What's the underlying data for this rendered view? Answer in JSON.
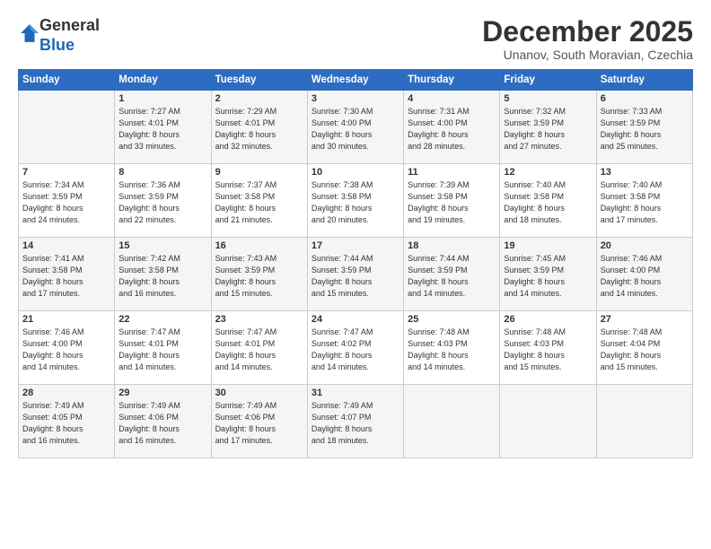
{
  "logo": {
    "general": "General",
    "blue": "Blue"
  },
  "header": {
    "month": "December 2025",
    "location": "Unanov, South Moravian, Czechia"
  },
  "weekdays": [
    "Sunday",
    "Monday",
    "Tuesday",
    "Wednesday",
    "Thursday",
    "Friday",
    "Saturday"
  ],
  "weeks": [
    [
      {
        "day": "",
        "info": ""
      },
      {
        "day": "1",
        "info": "Sunrise: 7:27 AM\nSunset: 4:01 PM\nDaylight: 8 hours\nand 33 minutes."
      },
      {
        "day": "2",
        "info": "Sunrise: 7:29 AM\nSunset: 4:01 PM\nDaylight: 8 hours\nand 32 minutes."
      },
      {
        "day": "3",
        "info": "Sunrise: 7:30 AM\nSunset: 4:00 PM\nDaylight: 8 hours\nand 30 minutes."
      },
      {
        "day": "4",
        "info": "Sunrise: 7:31 AM\nSunset: 4:00 PM\nDaylight: 8 hours\nand 28 minutes."
      },
      {
        "day": "5",
        "info": "Sunrise: 7:32 AM\nSunset: 3:59 PM\nDaylight: 8 hours\nand 27 minutes."
      },
      {
        "day": "6",
        "info": "Sunrise: 7:33 AM\nSunset: 3:59 PM\nDaylight: 8 hours\nand 25 minutes."
      }
    ],
    [
      {
        "day": "7",
        "info": "Sunrise: 7:34 AM\nSunset: 3:59 PM\nDaylight: 8 hours\nand 24 minutes."
      },
      {
        "day": "8",
        "info": "Sunrise: 7:36 AM\nSunset: 3:59 PM\nDaylight: 8 hours\nand 22 minutes."
      },
      {
        "day": "9",
        "info": "Sunrise: 7:37 AM\nSunset: 3:58 PM\nDaylight: 8 hours\nand 21 minutes."
      },
      {
        "day": "10",
        "info": "Sunrise: 7:38 AM\nSunset: 3:58 PM\nDaylight: 8 hours\nand 20 minutes."
      },
      {
        "day": "11",
        "info": "Sunrise: 7:39 AM\nSunset: 3:58 PM\nDaylight: 8 hours\nand 19 minutes."
      },
      {
        "day": "12",
        "info": "Sunrise: 7:40 AM\nSunset: 3:58 PM\nDaylight: 8 hours\nand 18 minutes."
      },
      {
        "day": "13",
        "info": "Sunrise: 7:40 AM\nSunset: 3:58 PM\nDaylight: 8 hours\nand 17 minutes."
      }
    ],
    [
      {
        "day": "14",
        "info": "Sunrise: 7:41 AM\nSunset: 3:58 PM\nDaylight: 8 hours\nand 17 minutes."
      },
      {
        "day": "15",
        "info": "Sunrise: 7:42 AM\nSunset: 3:58 PM\nDaylight: 8 hours\nand 16 minutes."
      },
      {
        "day": "16",
        "info": "Sunrise: 7:43 AM\nSunset: 3:59 PM\nDaylight: 8 hours\nand 15 minutes."
      },
      {
        "day": "17",
        "info": "Sunrise: 7:44 AM\nSunset: 3:59 PM\nDaylight: 8 hours\nand 15 minutes."
      },
      {
        "day": "18",
        "info": "Sunrise: 7:44 AM\nSunset: 3:59 PM\nDaylight: 8 hours\nand 14 minutes."
      },
      {
        "day": "19",
        "info": "Sunrise: 7:45 AM\nSunset: 3:59 PM\nDaylight: 8 hours\nand 14 minutes."
      },
      {
        "day": "20",
        "info": "Sunrise: 7:46 AM\nSunset: 4:00 PM\nDaylight: 8 hours\nand 14 minutes."
      }
    ],
    [
      {
        "day": "21",
        "info": "Sunrise: 7:46 AM\nSunset: 4:00 PM\nDaylight: 8 hours\nand 14 minutes."
      },
      {
        "day": "22",
        "info": "Sunrise: 7:47 AM\nSunset: 4:01 PM\nDaylight: 8 hours\nand 14 minutes."
      },
      {
        "day": "23",
        "info": "Sunrise: 7:47 AM\nSunset: 4:01 PM\nDaylight: 8 hours\nand 14 minutes."
      },
      {
        "day": "24",
        "info": "Sunrise: 7:47 AM\nSunset: 4:02 PM\nDaylight: 8 hours\nand 14 minutes."
      },
      {
        "day": "25",
        "info": "Sunrise: 7:48 AM\nSunset: 4:03 PM\nDaylight: 8 hours\nand 14 minutes."
      },
      {
        "day": "26",
        "info": "Sunrise: 7:48 AM\nSunset: 4:03 PM\nDaylight: 8 hours\nand 15 minutes."
      },
      {
        "day": "27",
        "info": "Sunrise: 7:48 AM\nSunset: 4:04 PM\nDaylight: 8 hours\nand 15 minutes."
      }
    ],
    [
      {
        "day": "28",
        "info": "Sunrise: 7:49 AM\nSunset: 4:05 PM\nDaylight: 8 hours\nand 16 minutes."
      },
      {
        "day": "29",
        "info": "Sunrise: 7:49 AM\nSunset: 4:06 PM\nDaylight: 8 hours\nand 16 minutes."
      },
      {
        "day": "30",
        "info": "Sunrise: 7:49 AM\nSunset: 4:06 PM\nDaylight: 8 hours\nand 17 minutes."
      },
      {
        "day": "31",
        "info": "Sunrise: 7:49 AM\nSunset: 4:07 PM\nDaylight: 8 hours\nand 18 minutes."
      },
      {
        "day": "",
        "info": ""
      },
      {
        "day": "",
        "info": ""
      },
      {
        "day": "",
        "info": ""
      }
    ]
  ]
}
